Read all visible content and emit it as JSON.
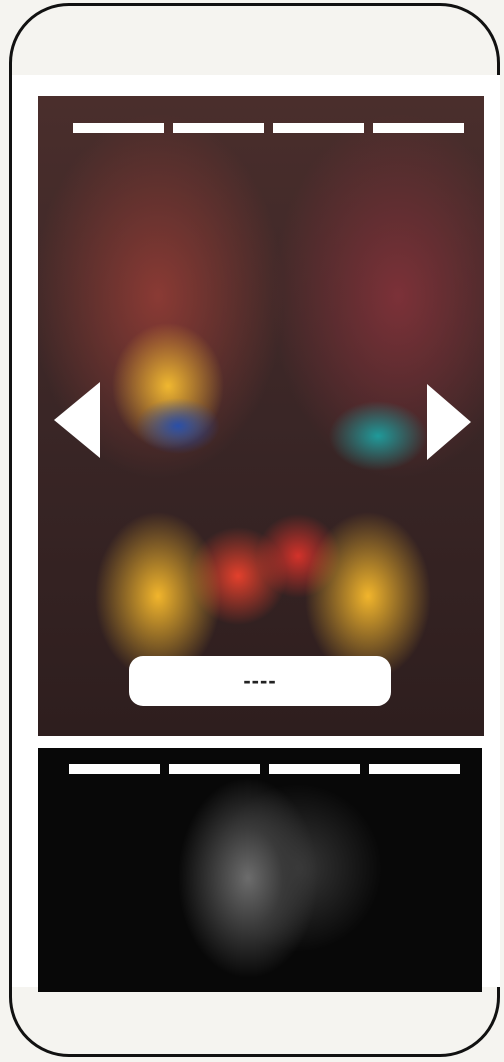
{
  "stories": [
    {
      "progress_segments": 4,
      "caption": "----"
    },
    {
      "progress_segments": 4
    }
  ],
  "icons": {
    "previous": "triangle-left-icon",
    "next": "triangle-right-icon"
  },
  "colors": {
    "frame": "#111111",
    "background": "#f5f4f0",
    "progress": "#ffffff"
  }
}
